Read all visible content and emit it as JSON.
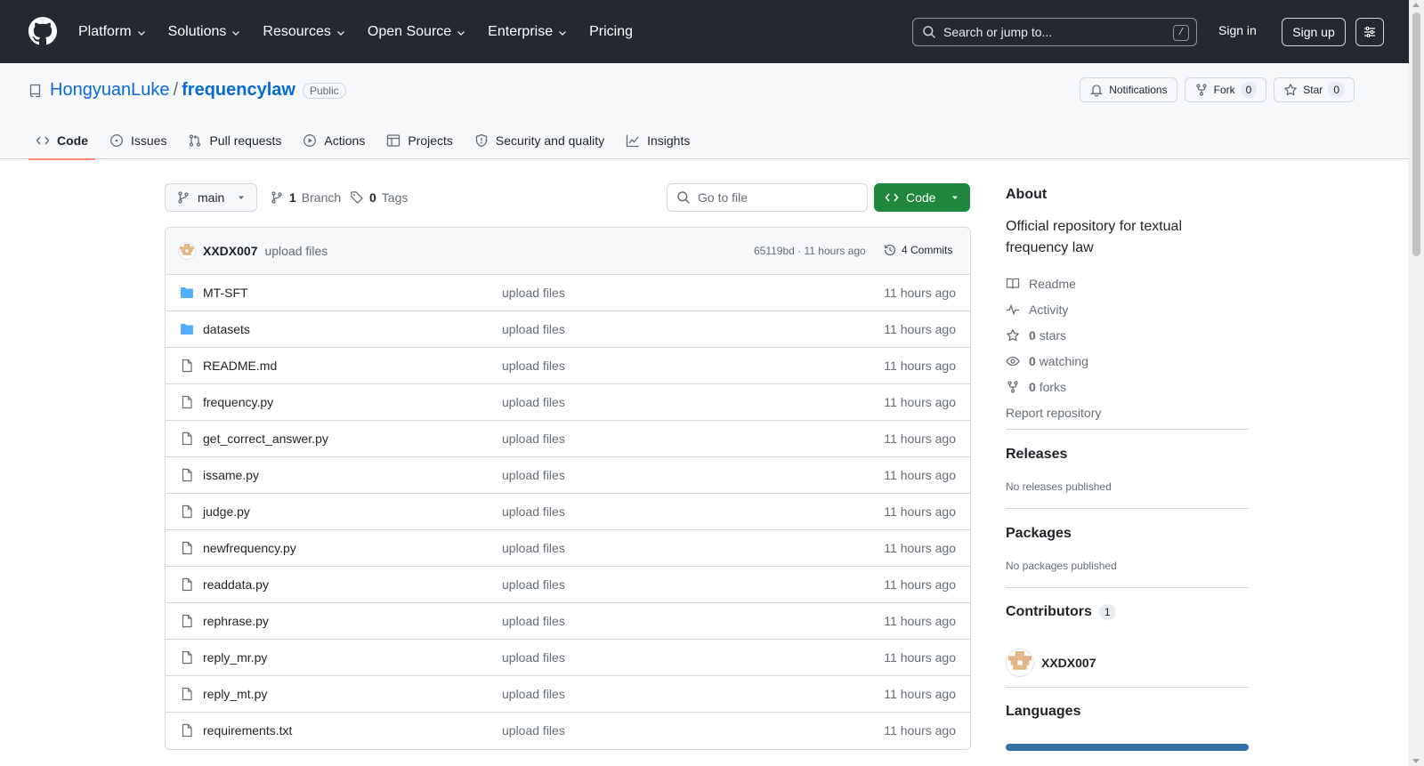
{
  "header": {
    "nav": [
      {
        "label": "Platform",
        "has_menu": true
      },
      {
        "label": "Solutions",
        "has_menu": true
      },
      {
        "label": "Resources",
        "has_menu": true
      },
      {
        "label": "Open Source",
        "has_menu": true
      },
      {
        "label": "Enterprise",
        "has_menu": true
      },
      {
        "label": "Pricing",
        "has_menu": false
      }
    ],
    "search_placeholder": "Search or jump to...",
    "search_shortcut": "/",
    "sign_in": "Sign in",
    "sign_up": "Sign up"
  },
  "repo": {
    "owner": "HongyuanLuke",
    "separator": "/",
    "name": "frequencylaw",
    "visibility": "Public",
    "notifications_label": "Notifications",
    "fork_label": "Fork",
    "fork_count": "0",
    "star_label": "Star",
    "star_count": "0",
    "tabs": [
      {
        "label": "Code",
        "icon": "code-icon",
        "active": true
      },
      {
        "label": "Issues",
        "icon": "issue-icon",
        "active": false
      },
      {
        "label": "Pull requests",
        "icon": "pull-request-icon",
        "active": false
      },
      {
        "label": "Actions",
        "icon": "play-icon",
        "active": false
      },
      {
        "label": "Projects",
        "icon": "table-icon",
        "active": false
      },
      {
        "label": "Security and quality",
        "icon": "shield-icon",
        "active": false
      },
      {
        "label": "Insights",
        "icon": "graph-icon",
        "active": false
      }
    ]
  },
  "browser": {
    "branch": "main",
    "branch_count": "1",
    "branch_label": "Branch",
    "tag_count": "0",
    "tag_label": "Tags",
    "goto_placeholder": "Go to file",
    "code_button": "Code",
    "commit": {
      "author": "XXDX007",
      "message": "upload files",
      "hash": "65119bd",
      "dot": "·",
      "time": "11 hours ago",
      "count_label": "4 Commits"
    },
    "files": [
      {
        "name": "MT-SFT",
        "type": "folder",
        "message": "upload files",
        "time": "11 hours ago"
      },
      {
        "name": "datasets",
        "type": "folder",
        "message": "upload files",
        "time": "11 hours ago"
      },
      {
        "name": "README.md",
        "type": "file",
        "message": "upload files",
        "time": "11 hours ago"
      },
      {
        "name": "frequency.py",
        "type": "file",
        "message": "upload files",
        "time": "11 hours ago"
      },
      {
        "name": "get_correct_answer.py",
        "type": "file",
        "message": "upload files",
        "time": "11 hours ago"
      },
      {
        "name": "issame.py",
        "type": "file",
        "message": "upload files",
        "time": "11 hours ago"
      },
      {
        "name": "judge.py",
        "type": "file",
        "message": "upload files",
        "time": "11 hours ago"
      },
      {
        "name": "newfrequency.py",
        "type": "file",
        "message": "upload files",
        "time": "11 hours ago"
      },
      {
        "name": "readdata.py",
        "type": "file",
        "message": "upload files",
        "time": "11 hours ago"
      },
      {
        "name": "rephrase.py",
        "type": "file",
        "message": "upload files",
        "time": "11 hours ago"
      },
      {
        "name": "reply_mr.py",
        "type": "file",
        "message": "upload files",
        "time": "11 hours ago"
      },
      {
        "name": "reply_mt.py",
        "type": "file",
        "message": "upload files",
        "time": "11 hours ago"
      },
      {
        "name": "requirements.txt",
        "type": "file",
        "message": "upload files",
        "time": "11 hours ago"
      }
    ]
  },
  "sidebar": {
    "about_title": "About",
    "description": "Official repository for textual frequency law",
    "readme": "Readme",
    "activity": "Activity",
    "stars_count": "0",
    "stars_label": "stars",
    "watching_count": "0",
    "watching_label": "watching",
    "forks_count": "0",
    "forks_label": "forks",
    "report": "Report repository",
    "releases_title": "Releases",
    "releases_empty": "No releases published",
    "packages_title": "Packages",
    "packages_empty": "No packages published",
    "contributors_title": "Contributors",
    "contributors_count": "1",
    "contributor_name": "XXDX007",
    "languages_title": "Languages"
  },
  "colors": {
    "header_bg": "#24292f",
    "link": "#0969da",
    "primary_button": "#1f883d",
    "active_tab_underline": "#fd8c73",
    "folder_icon": "#54aeff",
    "language_bar": "#3572a5"
  }
}
